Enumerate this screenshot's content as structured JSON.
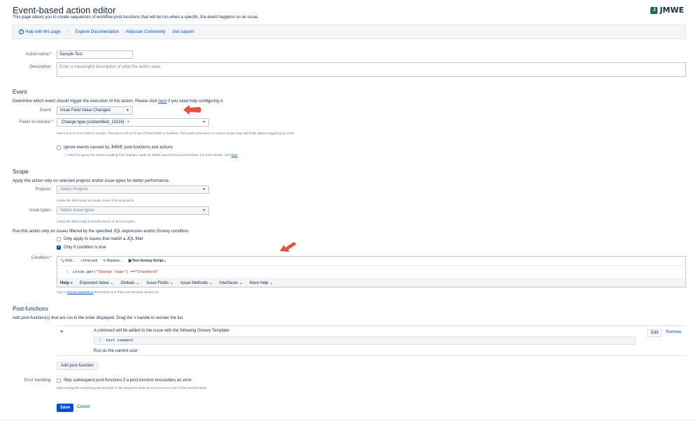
{
  "header": {
    "title": "Event-based action editor",
    "subtitle": "This page allows you to create sequences of workflow post-functions that will be run when a specific Jira event happens on an issue.",
    "logo_text": "JMWE"
  },
  "helpbar": {
    "help_page": "Help with this page",
    "documentation": "Explore Documentation",
    "community": "Atlassian Community",
    "support": "Get support"
  },
  "action": {
    "name_label": "Action name:",
    "name_value": "Sample Test",
    "description_label": "Description:",
    "description_placeholder": "Enter a meaningful description of what the action does."
  },
  "event": {
    "heading": "Event",
    "intro_pre": "Determine which event should trigger the execution of this action. Please click",
    "intro_link": "here",
    "intro_post": "if you need help configuring it.",
    "event_label": "Event:",
    "event_value": "Issue Field Value Changed",
    "fields_label": "Fields to monitor:",
    "fields_tag": "Change type (customfield_10116)",
    "fields_hint": "Select one or more fields to monitor. The action will run if one of these fields is modified. Third party extensions or custom scripts may edit fields without triggering an event.",
    "ignore_label": "Ignore events caused by JMWE post-functions and actions",
    "ignore_hint_pre": "Select to ignore the events resulting from changes made by JMWE post-functions and actions. For more details, click",
    "ignore_hint_link": "here"
  },
  "scope": {
    "heading": "Scope",
    "intro": "Apply this action only on selected projects and/or issue types for better performance.",
    "projects_label": "Projects:",
    "projects_placeholder": "Select Projects",
    "projects_hint": "Leave this field empty to handle issues from all projects.",
    "issue_types_label": "Issue types:",
    "issue_types_placeholder": "Select Issue types",
    "issue_types_hint": "Leave this field empty to handle issues of all issue types.",
    "filter_intro": "Run this action only on issues filtered by the specified JQL expression and/or Groovy condition.",
    "jql_label": "Only apply to issues that match a JQL filter",
    "condition_check_label": "Only if condition is true",
    "condition_label": "Condition:",
    "toolbar": {
      "find": "Find...",
      "find_next": "Find next",
      "replace": "Replace...",
      "test": "Test Groovy Script..."
    },
    "code_line_no": "1",
    "code_pre": "issue.get(",
    "code_str1": "\"Change type\"",
    "code_mid": ") == ",
    "code_str2": "\"Standard\"",
    "help_bar": {
      "help": "Help",
      "expected_value": "Expected Value",
      "globals": "Globals",
      "issue_fields": "Issue Fields",
      "issue_methods": "Issue Methods",
      "interfaces": "Interfaces",
      "more_help": "More help"
    },
    "condition_hint_pre": "Type a",
    "condition_hint_link": "Groovy expression",
    "condition_hint_post": "that returns true if the post-function should run."
  },
  "post_functions": {
    "heading": "Post-functions",
    "intro_pre": "Add post-function(s) that are run in the order displayed. Drag the",
    "intro_handle": "≡",
    "intro_post": "handle to reorder the list.",
    "item_title": "A comment will be added to the issue with the following Groovy Template:",
    "item_code_line": "1",
    "item_code": "test comment",
    "item_run_as": "Run as the current user",
    "edit": "Edit",
    "remove": "Remove",
    "add_button": "Add post-function"
  },
  "error_handling": {
    "label": "Error handling:",
    "checkbox_label": "Skip subsequent post-functions if a post-function encounters an error",
    "hint": "Skip running the remaining post functions in the sequence when an error occurs in one of the post functions."
  },
  "actions": {
    "save": "Save",
    "cancel": "Cancel"
  },
  "colors": {
    "accent": "#0052cc",
    "arrow": "#e8513b"
  }
}
